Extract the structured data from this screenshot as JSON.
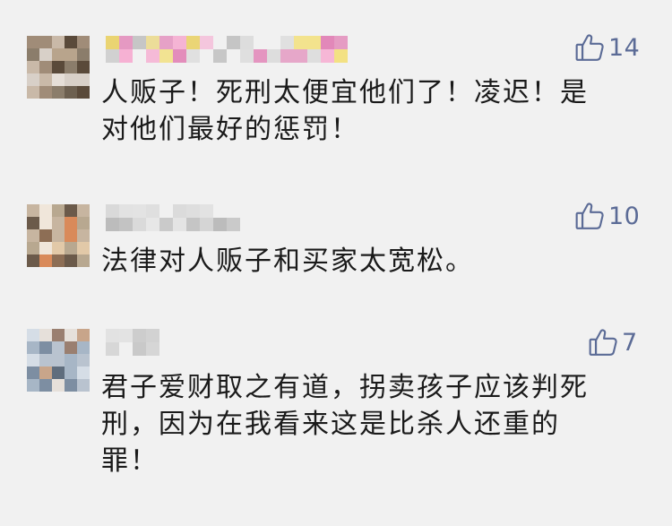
{
  "comments": [
    {
      "likes": "14",
      "text": "人贩子！死刑太便宜他们了！凌迟！是\n对他们最好的惩罚！"
    },
    {
      "likes": "10",
      "text": "法律对人贩子和买家太宽松。"
    },
    {
      "likes": "7",
      "text": "君子爱财取之有道，拐卖孩子应该判死\n刑，因为在我看来这是比杀人还重的\n罪！"
    }
  ],
  "colors": {
    "background": "#f1f1f1",
    "text": "#1a1a1a",
    "like_icon": "#5b6b96"
  },
  "icons": {
    "like": "thumbs-up-icon",
    "avatar": "blurred-avatar",
    "username": "blurred-username"
  }
}
